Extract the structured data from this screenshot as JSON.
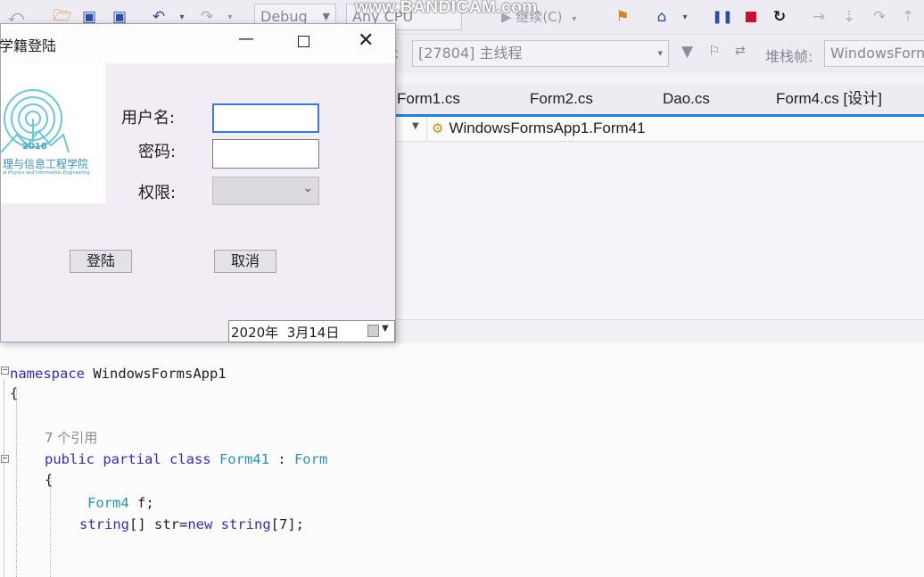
{
  "watermark": "www.BANDICAM.com",
  "toolbar": {
    "config_combo": "Debug",
    "platform_combo": "Any CPU",
    "continue_label": "继续(C)",
    "thread_combo": "[27804] 主线程",
    "stackframe_label": "堆栈帧:",
    "stackframe_combo": "WindowsForm"
  },
  "tabs": [
    "Form1.cs",
    "Form2.cs",
    "Dao.cs",
    "Form4.cs [设计]"
  ],
  "navbar": {
    "member": "WindowsFormsApp1.Form41"
  },
  "dialog": {
    "title": "学籍登陆",
    "logo_year": "2018",
    "logo_text": "理与信息工程学院",
    "logo_subtext": "al Physics and Information Engineering",
    "username_label": "用户名:",
    "password_label": "密码:",
    "permission_label": "权限:",
    "username_value": "",
    "password_value": "",
    "permission_value": "",
    "login_button": "登陆",
    "cancel_button": "取消",
    "date_value": "2020年  3月14日"
  },
  "code": {
    "line1_kw": "namespace",
    "line1_name": " WindowsFormsApp1",
    "line2": "{",
    "refs": "7 个引用",
    "line4_kw": "public partial class",
    "line4_name": " Form41",
    "line4_colon": " : ",
    "line4_base": "Form",
    "line5": "{",
    "line6_type": "Form4",
    "line6_rest": " f;",
    "line7_kw": "string",
    "line7_mid": "[] str=",
    "line7_new": "new",
    "line7_kw2": " string",
    "line7_end": "[7];"
  },
  "colors": {
    "keyword": "#2f2fb5",
    "type": "#2b91af",
    "accent": "#2a7fd4",
    "stop": "#c8102e"
  }
}
